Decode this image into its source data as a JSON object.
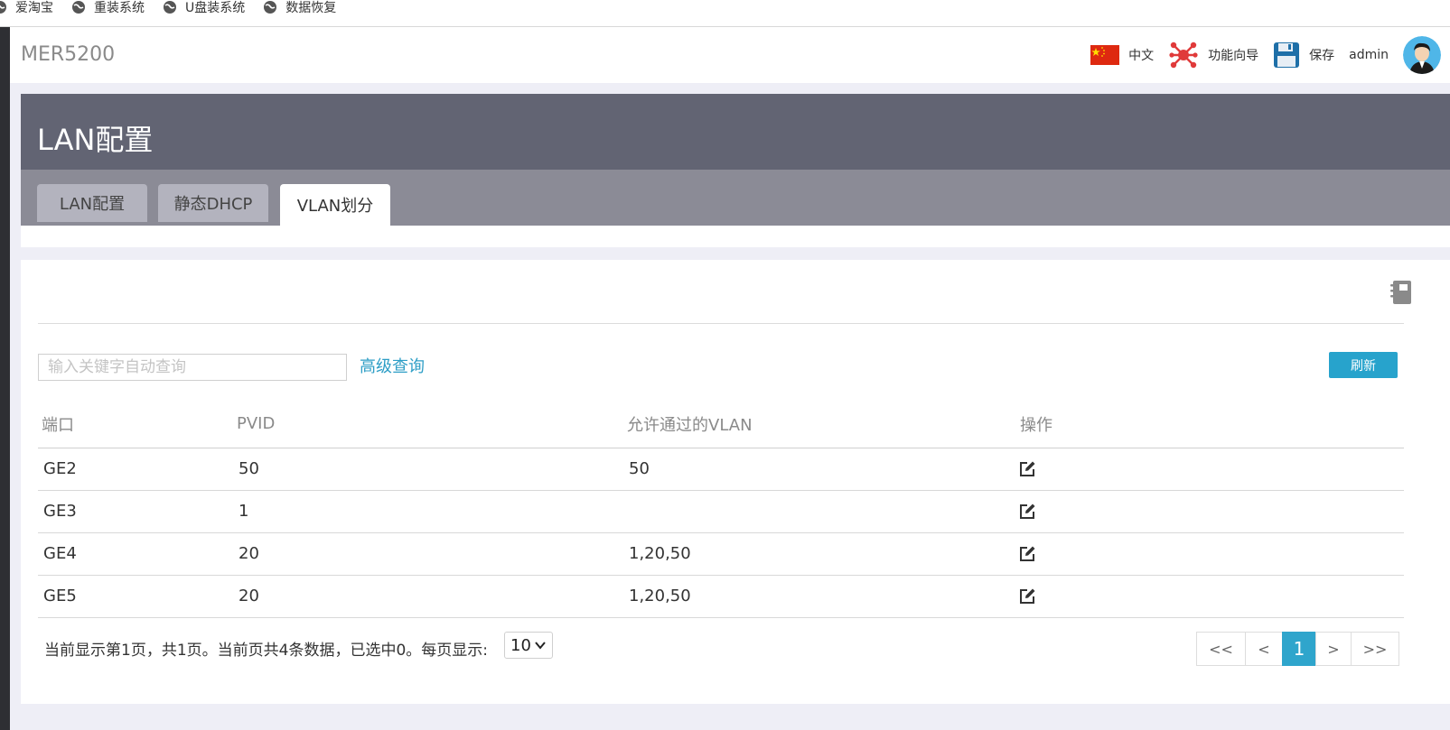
{
  "bookmarks": [
    "爱淘宝",
    "重装系统",
    "U盘装系统",
    "数据恢复"
  ],
  "header": {
    "brand": "MER5200",
    "language": "中文",
    "wizard": "功能向导",
    "save": "保存",
    "user": "admin"
  },
  "page": {
    "title": "LAN配置",
    "tabs": [
      "LAN配置",
      "静态DHCP",
      "VLAN划分"
    ],
    "active_tab": "VLAN划分"
  },
  "toolbar": {
    "search_placeholder": "输入关键字自动查询",
    "advanced_query": "高级查询",
    "refresh": "刷新"
  },
  "table": {
    "headers": [
      "端口",
      "PVID",
      "允许通过的VLAN",
      "操作"
    ],
    "rows": [
      {
        "port": "GE2",
        "pvid": "50",
        "allowed": "50"
      },
      {
        "port": "GE3",
        "pvid": "1",
        "allowed": ""
      },
      {
        "port": "GE4",
        "pvid": "20",
        "allowed": "1,20,50"
      },
      {
        "port": "GE5",
        "pvid": "20",
        "allowed": "1,20,50"
      }
    ]
  },
  "pager": {
    "summary": "当前显示第1页，共1页。当前页共4条数据，已选中0。每页显示:",
    "page_size": "10",
    "buttons": [
      "<<",
      "<",
      "1",
      ">",
      ">>"
    ],
    "current": "1"
  },
  "colors": {
    "banner": "#626473",
    "tabbar": "#8b8b96",
    "accent": "#27a3cc"
  },
  "icons": [
    "globe-icon",
    "china-flag-icon",
    "wizard-icon",
    "save-disk-icon",
    "user-avatar-icon",
    "notebook-icon",
    "edit-icon"
  ]
}
